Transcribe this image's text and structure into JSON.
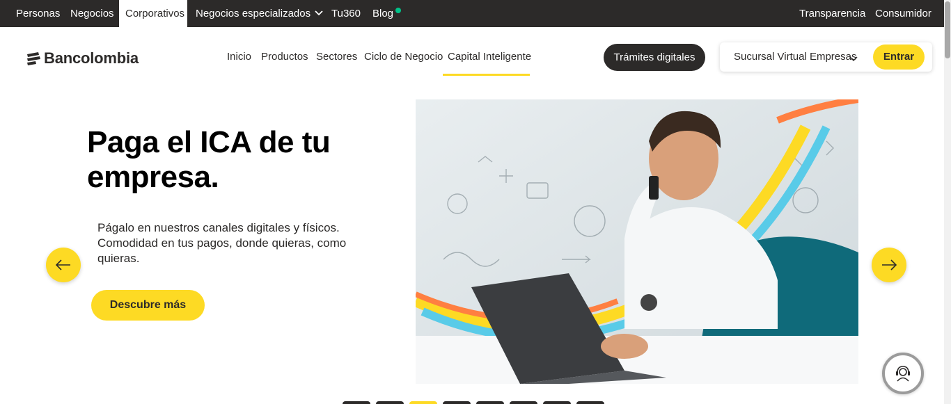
{
  "topbar": {
    "items": [
      {
        "label": "Personas"
      },
      {
        "label": "Negocios"
      },
      {
        "label": "Corporativos",
        "active": true
      },
      {
        "label": "Negocios especializados"
      },
      {
        "label": "Tu360"
      },
      {
        "label": "Blog"
      }
    ],
    "right": [
      {
        "label": "Transparencia"
      },
      {
        "label": "Consumidor"
      }
    ]
  },
  "header": {
    "logo_text": "Bancolombia",
    "nav": [
      {
        "label": "Inicio"
      },
      {
        "label": "Productos"
      },
      {
        "label": "Sectores"
      },
      {
        "label": "Ciclo de Negocio"
      },
      {
        "label": "Capital Inteligente",
        "active": true
      }
    ],
    "tramites_label": "Trámites digitales",
    "sucursal_label": "Sucursal Virtual Empresas",
    "entrar_label": "Entrar"
  },
  "hero": {
    "title": "Paga el ICA de tu empresa.",
    "text": "Págalo en nuestros canales digitales y físicos. Comodidad en tus pagos, donde quieras, como quieras.",
    "cta_label": "Descubre más",
    "image_alt_scene": "man-with-phone-and-laptop"
  },
  "carousel": {
    "slide_count": 8,
    "active_index": 2
  },
  "colors": {
    "brand_yellow": "#fdda24",
    "dark": "#2c2a29",
    "online_dot": "#00c389"
  },
  "icons": {
    "prev": "arrow-left-icon",
    "next": "arrow-right-icon",
    "help": "support-agent-icon",
    "dropdown": "chevron-down-icon"
  }
}
